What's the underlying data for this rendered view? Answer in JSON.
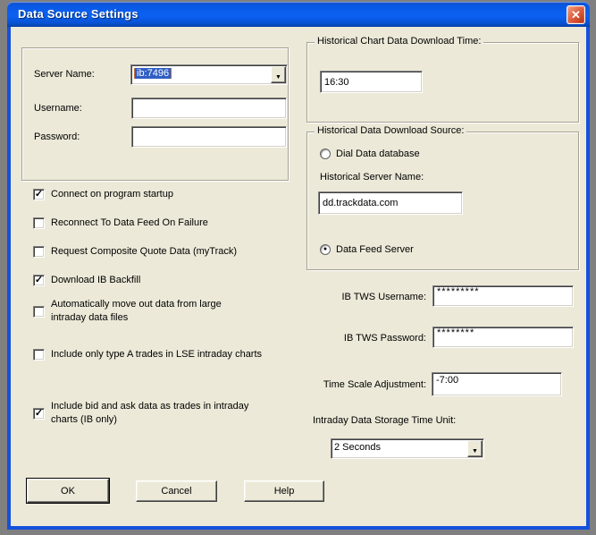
{
  "window": {
    "title": "Data Source Settings"
  },
  "icons": {
    "close": "✕",
    "chevron_down": "▼"
  },
  "colors": {
    "titlebar_blue": "#0b5fee",
    "window_border_blue": "#1550dc",
    "dialog_background": "#ECE9D8",
    "selection_highlight": "#2f5fc4",
    "close_button_red": "#d2492a",
    "desktop_gray": "#808080"
  },
  "server_group": {
    "server_name_label": "Server Name:",
    "server_name_value": "ib:7496",
    "username_label": "Username:",
    "username_value": "",
    "password_label": "Password:",
    "password_value": ""
  },
  "checkboxes": [
    {
      "label": "Connect on program startup",
      "glyph": "✓",
      "checked": true
    },
    {
      "label": "Reconnect To Data Feed On Failure",
      "glyph": "",
      "checked": false
    },
    {
      "label": "Request Composite Quote Data (myTrack)",
      "glyph": "",
      "checked": false
    },
    {
      "label": "Download IB Backfill",
      "glyph": "✓",
      "checked": true
    },
    {
      "label": "Automatically move out data from large intraday data files",
      "glyph": "",
      "checked": false
    },
    {
      "label": "Include only type A trades in LSE intraday charts",
      "glyph": "",
      "checked": false
    },
    {
      "label": "Include bid and ask data as trades in intraday charts (IB only)",
      "glyph": "✓",
      "checked": true
    }
  ],
  "historical_time_group": {
    "legend": "Historical Chart Data Download Time:",
    "time_value": "16:30"
  },
  "historical_source_group": {
    "legend": "Historical Data Download Source:",
    "dial_data_label": "Dial Data database",
    "dial_data_glyph": "",
    "server_name_label": "Historical Server Name:",
    "server_name_value": "dd.trackdata.com",
    "data_feed_label": "Data Feed Server",
    "data_feed_glyph": "●"
  },
  "ib_tws": {
    "username_label": "IB TWS Username:",
    "username_value": "*********",
    "password_label": "IB TWS Password:",
    "password_value": "********"
  },
  "time_scale": {
    "label": "Time Scale Adjustment:",
    "value": "-7:00"
  },
  "storage_unit": {
    "label": "Intraday Data Storage Time Unit:",
    "value": "2 Seconds"
  },
  "buttons": {
    "ok": "OK",
    "cancel": "Cancel",
    "help": "Help"
  }
}
